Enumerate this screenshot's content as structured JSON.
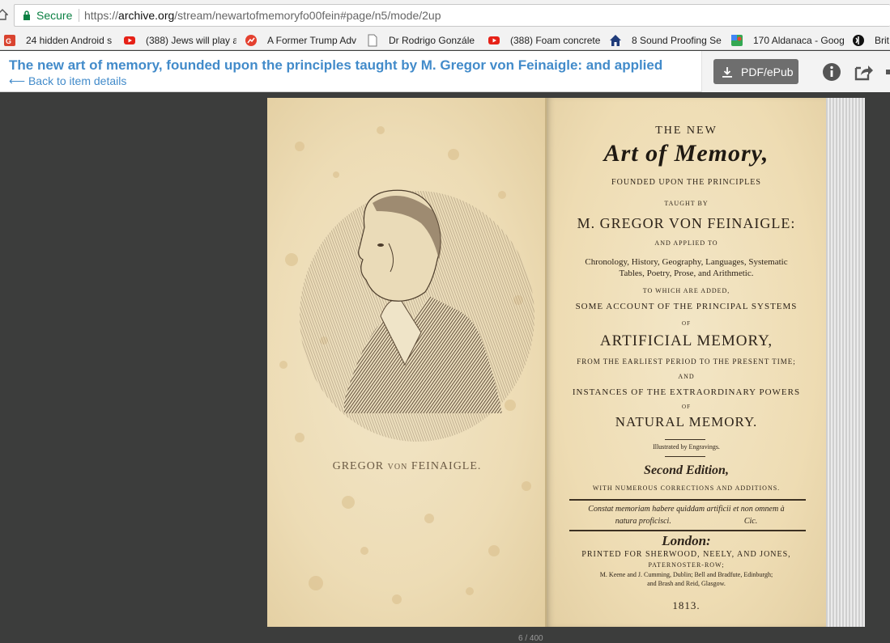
{
  "browser": {
    "secure_label": "Secure",
    "url_scheme": "https://",
    "url_host": "archive.org",
    "url_path": "/stream/newartofmemoryfo00fein#page/n5/mode/2up"
  },
  "bookmarks": [
    {
      "label": "24 hidden Android s",
      "icon": "red-square-icon",
      "color": "#d9432f"
    },
    {
      "label": "(388) Jews will play a",
      "icon": "youtube-icon",
      "color": "#e62117"
    },
    {
      "label": "A Former Trump Adv",
      "icon": "trend-icon",
      "color": "#e4402f"
    },
    {
      "label": "Dr Rodrigo Gonzále",
      "icon": "page-icon",
      "color": "#777777"
    },
    {
      "label": "(388) Foam concrete",
      "icon": "youtube-icon",
      "color": "#e62117"
    },
    {
      "label": "8 Sound Proofing Se",
      "icon": "house-icon",
      "color": "#1f3b7a"
    },
    {
      "label": "170 Aldanaca - Goog",
      "icon": "maps-icon",
      "color": "#34a853"
    },
    {
      "label": "Brit",
      "icon": "brit-icon",
      "color": "#111111"
    }
  ],
  "header": {
    "title": "The new art of memory, founded upon the principles taught by M. Gregor von Feinaigle: and applied",
    "back_link": "⟵ Back to item details",
    "pdf_button": "PDF/ePub",
    "accent": "#428bca"
  },
  "left_page": {
    "caption_1": "GREGOR ",
    "caption_2": "VON",
    "caption_3": " FEINAIGLE."
  },
  "title_page": {
    "the_new": "THE NEW",
    "art": "Art of Memory,",
    "founded": "FOUNDED UPON THE PRINCIPLES",
    "taught_by": "TAUGHT BY",
    "author": "M. GREGOR VON FEINAIGLE:",
    "applied_to": "AND APPLIED TO",
    "subjects_1": "Chronology, History, Geography, Languages, Systematic",
    "subjects_2": "Tables, Poetry, Prose, and Arithmetic.",
    "to_which": "TO WHICH ARE ADDED,",
    "some_account": "SOME ACCOUNT OF THE PRINCIPAL SYSTEMS",
    "of_1": "OF",
    "artificial": "ARTIFICIAL MEMORY,",
    "from_earliest": "FROM THE EARLIEST PERIOD TO THE PRESENT TIME;",
    "and": "AND",
    "instances": "INSTANCES OF THE EXTRAORDINARY POWERS",
    "of_2": "OF",
    "natural": "NATURAL MEMORY.",
    "illustrated": "Illustrated by Engravings.",
    "edition": "Second Edition,",
    "corrections": "WITH NUMEROUS CORRECTIONS AND ADDITIONS.",
    "quote_1": "Constat memoriam habere quiddam artificii et non omnem à",
    "quote_2": "natura proficisci.                                    Cic.",
    "london": "London:",
    "printed": "PRINTED FOR SHERWOOD, NEELY, AND JONES,",
    "paternoster": "PATERNOSTER-ROW;",
    "keene_1": "M. Keene and J. Cumming, Dublin; Bell and Bradfute, Edinburgh;",
    "keene_2": "and Brash and Reid, Glasgow.",
    "year": "1813."
  },
  "footer": {
    "page_count": "6 / 400"
  }
}
